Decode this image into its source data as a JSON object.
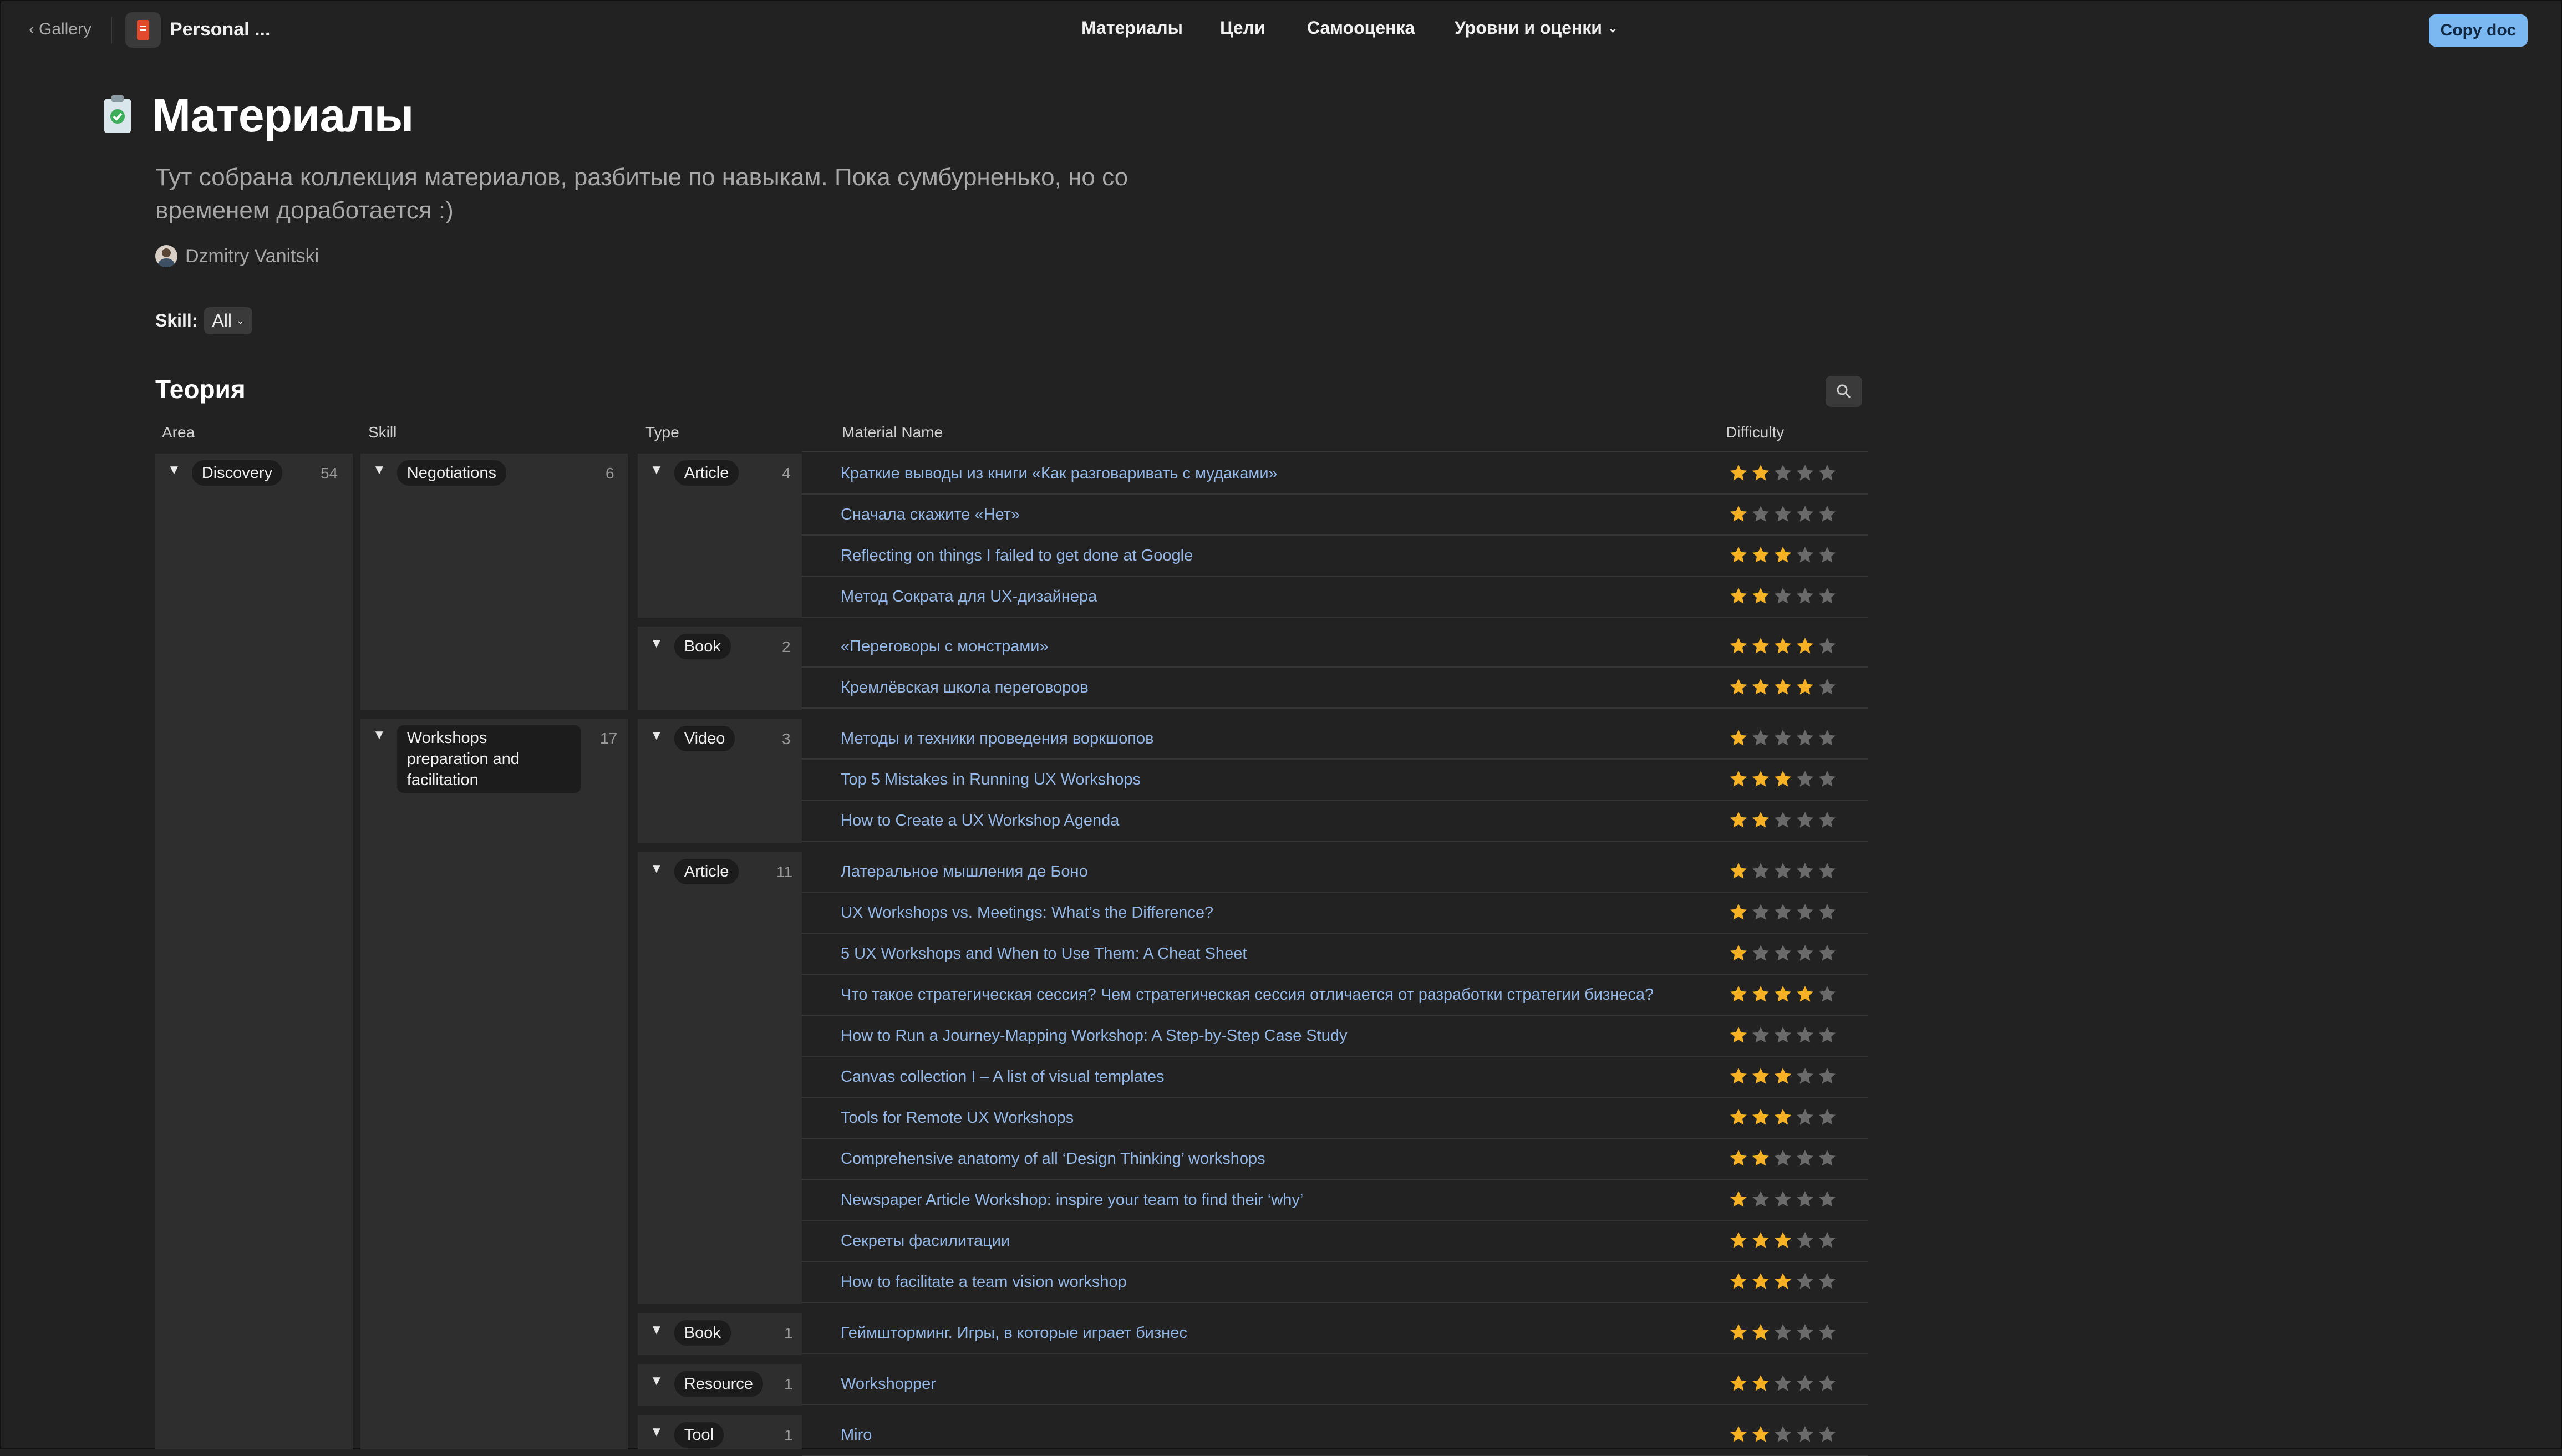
{
  "topbar": {
    "back_label": "Gallery",
    "doc_title": "Personal ...",
    "nav": [
      "Материалы",
      "Цели",
      "Самооценка",
      "Уровни и оценки"
    ],
    "copy_label": "Copy doc"
  },
  "page": {
    "title": "Материалы",
    "description": "Тут собрана коллекция материалов, разбитые по навыкам. Пока сумбурненько, но со временем доработается :)",
    "author": "Dzmitry Vanitski"
  },
  "filter": {
    "label": "Skill:",
    "value": "All"
  },
  "section": {
    "title": "Теория"
  },
  "columns": [
    "Area",
    "Skill",
    "Type",
    "Material Name",
    "Difficulty"
  ],
  "colors": {
    "accent": "#7bb7f0",
    "star_on": "#f6b124",
    "star_off": "#6a6a6a",
    "link": "#93b7e6"
  },
  "areas": [
    {
      "label": "Discovery",
      "count": "54"
    }
  ],
  "skills": [
    {
      "label": "Negotiations",
      "count": "6"
    },
    {
      "label": "Workshops preparation and facilitation",
      "count": "17"
    }
  ],
  "types": [
    {
      "label": "Article",
      "count": "4"
    },
    {
      "label": "Book",
      "count": "2"
    },
    {
      "label": "Video",
      "count": "3"
    },
    {
      "label": "Article",
      "count": "11"
    },
    {
      "label": "Book",
      "count": "1"
    },
    {
      "label": "Resource",
      "count": "1"
    },
    {
      "label": "Tool",
      "count": "1"
    }
  ],
  "materials": [
    {
      "name": "Краткие выводы из книги «Как разговаривать с мудаками»",
      "difficulty": 2
    },
    {
      "name": "Сначала скажите «Нет»",
      "difficulty": 1
    },
    {
      "name": "Reflecting on things I failed to get done at Google",
      "difficulty": 3
    },
    {
      "name": "Метод Сократа для UX-дизайнера",
      "difficulty": 2
    },
    {
      "name": "«Переговоры с монстрами»",
      "difficulty": 4
    },
    {
      "name": "Кремлёвская школа переговоров",
      "difficulty": 4
    },
    {
      "name": "Методы и техники проведения воркшопов",
      "difficulty": 1
    },
    {
      "name": "Top 5 Mistakes in Running UX Workshops",
      "difficulty": 3
    },
    {
      "name": "How to Create a UX Workshop Agenda",
      "difficulty": 2
    },
    {
      "name": "Латеральное мышления де Боно",
      "difficulty": 1
    },
    {
      "name": "UX Workshops vs. Meetings: What’s the Difference?",
      "difficulty": 1
    },
    {
      "name": "5 UX Workshops and When to Use Them: A Cheat Sheet",
      "difficulty": 1
    },
    {
      "name": "Что такое стратегическая сессия? Чем стратегическая сессия отличается от разработки стратегии бизнеса?",
      "difficulty": 4
    },
    {
      "name": "How to Run a Journey-Mapping Workshop: A Step-by-Step Case Study",
      "difficulty": 1
    },
    {
      "name": "Canvas collection I – A list of visual templates",
      "difficulty": 3
    },
    {
      "name": "Tools for Remote UX Workshops",
      "difficulty": 3
    },
    {
      "name": "Comprehensive anatomy of all ‘Design Thinking’ workshops",
      "difficulty": 2
    },
    {
      "name": "Newspaper Article Workshop: inspire your team to find their ‘why’",
      "difficulty": 1
    },
    {
      "name": "Секреты фасилитации",
      "difficulty": 3
    },
    {
      "name": "How to facilitate a team vision workshop",
      "difficulty": 3
    },
    {
      "name": "Геймшторминг. Игры, в которые играет бизнес",
      "difficulty": 2
    },
    {
      "name": "Workshopper",
      "difficulty": 2
    },
    {
      "name": "Miro",
      "difficulty": 2
    }
  ]
}
